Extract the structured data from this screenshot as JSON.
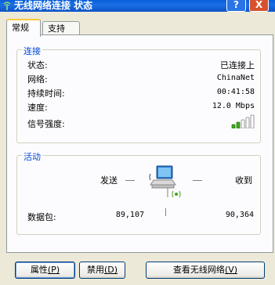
{
  "window": {
    "title": "无线网络连接 状态",
    "help_label": "?",
    "close_label": "X"
  },
  "tabs": [
    {
      "label": "常规",
      "active": true
    },
    {
      "label": "支持",
      "active": false
    }
  ],
  "connection": {
    "group_title": "连接",
    "rows": [
      {
        "label": "状态:",
        "value": "已连接上"
      },
      {
        "label": "网络:",
        "value": "ChinaNet"
      },
      {
        "label": "持续时间:",
        "value": "00:41:58"
      },
      {
        "label": "速度:",
        "value": "12.0 Mbps"
      }
    ],
    "signal_label": "信号强度:",
    "signal_icon": "signal-bars-icon",
    "signal_bars_lit": 2,
    "signal_bars_total": 5
  },
  "activity": {
    "group_title": "活动",
    "sent_label": "发送",
    "received_label": "收到",
    "packets_label": "数据包:",
    "packets_sent": "89,107",
    "packets_received": "90,364",
    "icon": "wireless-computer-icon"
  },
  "buttons": {
    "properties": {
      "text": "属性",
      "key": "(P)"
    },
    "disable": {
      "text": "禁用",
      "key": "(D)"
    },
    "view": {
      "text": "查看无线网络",
      "key": "(V)"
    }
  },
  "colors": {
    "title_bar": "#0A5FD8",
    "group_title": "#0046D5",
    "signal_green": "#3FA61E",
    "close_red": "#D8512E"
  }
}
